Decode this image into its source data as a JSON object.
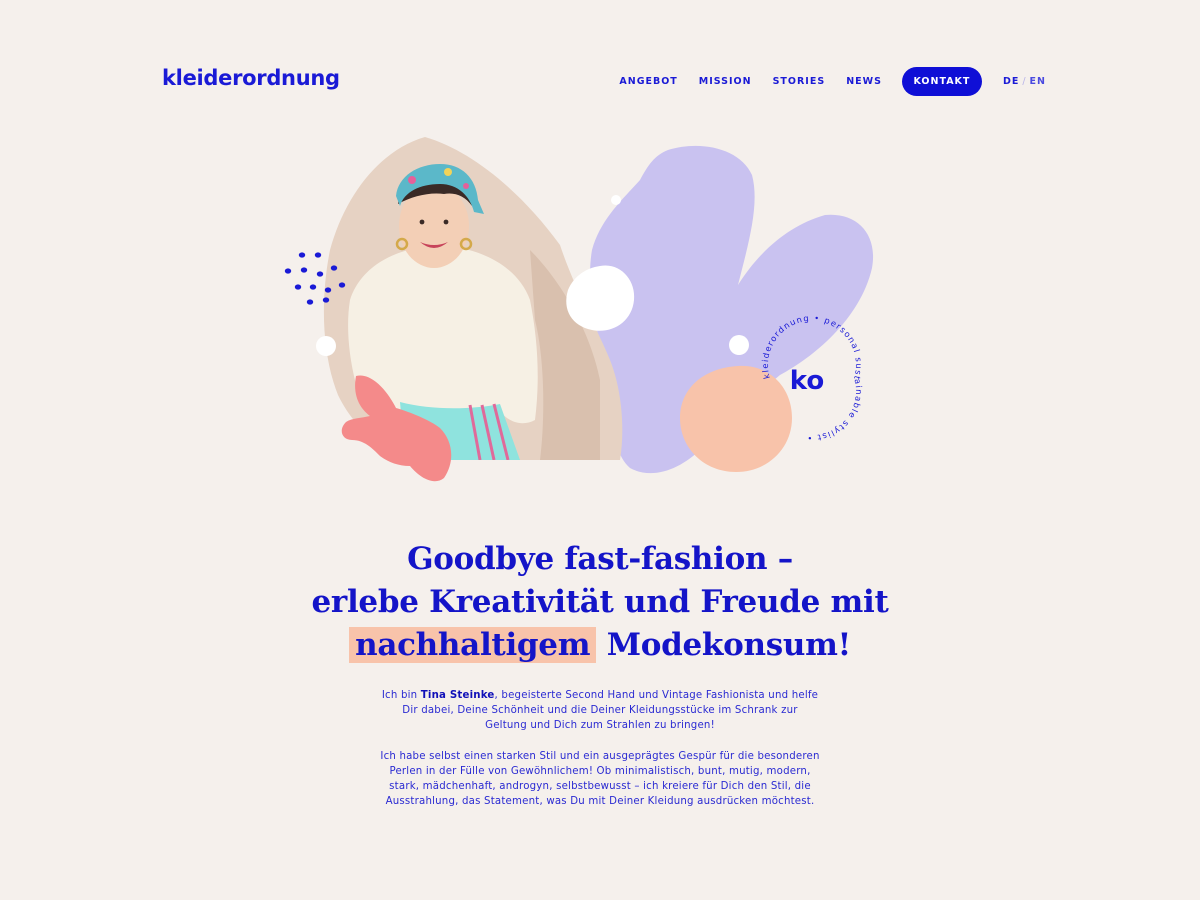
{
  "brand": {
    "logo_text": "kleiderordnung"
  },
  "nav": {
    "items": [
      "ANGEBOT",
      "MISSION",
      "STORIES",
      "NEWS"
    ],
    "cta_label": "KONTAKT",
    "lang_active": "DE",
    "lang_separator": "/",
    "lang_other": "EN"
  },
  "badge": {
    "monogram": "ko",
    "ring_text": "kleiderordnung • personal sustainable stylist •"
  },
  "headline": {
    "line1": "Goodbye fast-fashion –",
    "line2": "erlebe Kreativität und Freude mit",
    "highlight": "nachhaltigem",
    "line3_rest": " Modekonsum!"
  },
  "intro": {
    "p1_before": "Ich bin ",
    "p1_name": "Tina Steinke",
    "p1_after": ", begeisterte Second Hand und Vintage Fashionista und helfe Dir dabei, Deine Schönheit und die Deiner Kleidungsstücke im Schrank zur Geltung und Dich zum Strahlen zu bringen!",
    "p2": "Ich habe selbst einen starken Stil und ein ausgeprägtes Gespür für die besonderen Perlen in der Fülle von Gewöhnlichem! Ob minimalistisch, bunt, mutig, modern, stark, mädchenhaft, androgyn, selbstbewusst – ich kreiere für Dich den Stil, die Ausstrahlung, das Statement, was Du mit Deiner Kleidung ausdrücken möchtest."
  },
  "colors": {
    "primary": "#1a1ad6",
    "background": "#f5f0ec",
    "lavender": "#c9c2f0",
    "peach": "#f8c3aa",
    "coral": "#f48a8a",
    "beige": "#e6d2c3"
  }
}
